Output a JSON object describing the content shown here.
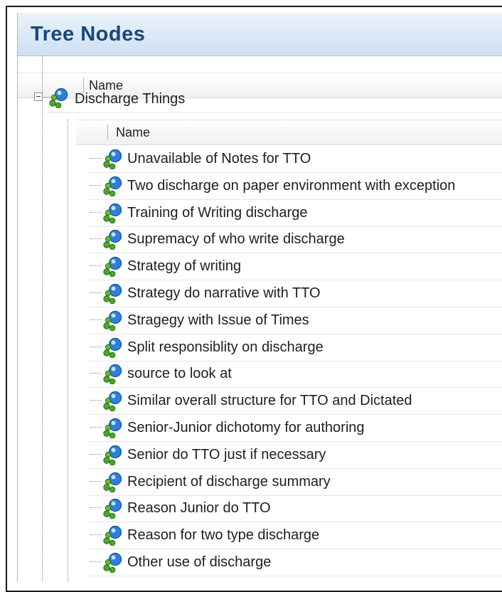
{
  "panel": {
    "title": "Tree Nodes"
  },
  "outer_header": {
    "column_name": "Name"
  },
  "parent_node": {
    "label": "Discharge Things",
    "icon": "node-icon",
    "expanded": true
  },
  "child_header": {
    "column_name": "Name"
  },
  "children": [
    "Unavailable of Notes for TTO",
    "Two discharge on paper environment with exception",
    "Training of Writing discharge",
    "Supremacy of who write discharge",
    "Strategy of writing",
    "Strategy do narrative with TTO",
    "Stragegy with Issue of Times",
    "Split responsiblity on discharge",
    "source to look at",
    "Similar overall structure for TTO and Dictated",
    "Senior-Junior dichotomy  for authoring",
    "Senior do TTO just if necessary",
    "Recipient of discharge summary",
    "Reason Junior do TTO",
    "Reason for two type discharge",
    "Other use of discharge"
  ],
  "colors": {
    "title": "#17477c",
    "title_bg": "#cfe0f2",
    "text": "#1e1e1e"
  }
}
